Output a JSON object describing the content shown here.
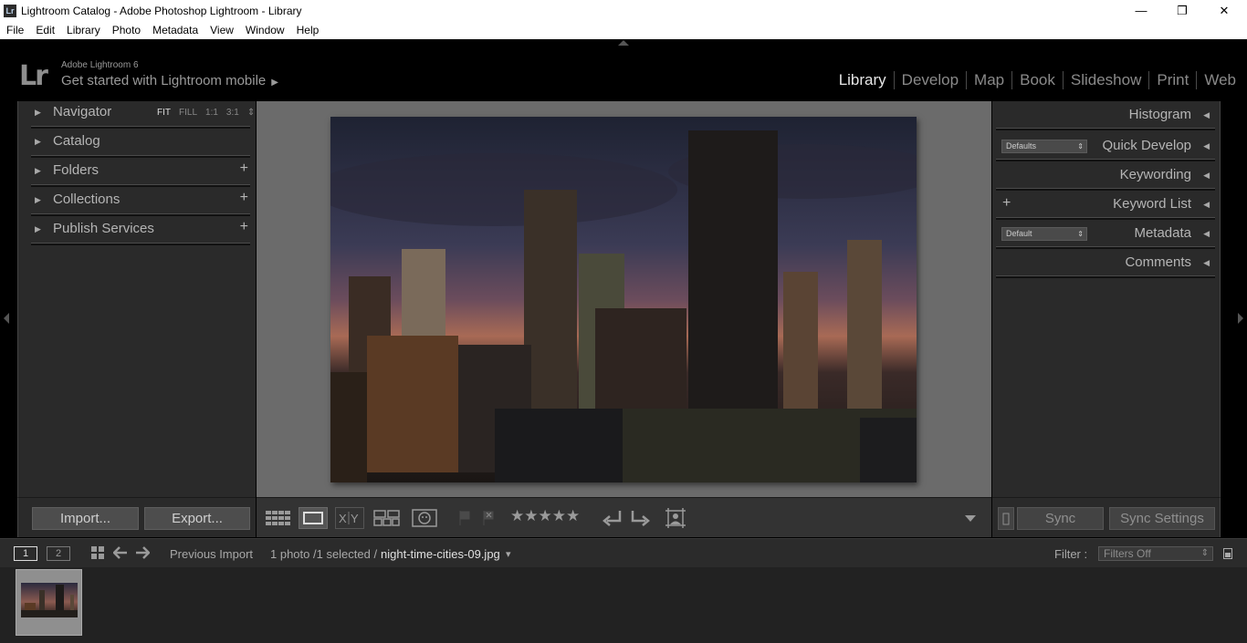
{
  "window": {
    "app_badge": "Lr",
    "title": "Lightroom Catalog - Adobe Photoshop Lightroom - Library",
    "minimize": "—",
    "restore": "❐",
    "close": "✕"
  },
  "menu": [
    "File",
    "Edit",
    "Library",
    "Photo",
    "Metadata",
    "View",
    "Window",
    "Help"
  ],
  "identity": {
    "logo": "Lr",
    "product": "Adobe Lightroom 6",
    "tagline": "Get started with Lightroom mobile",
    "tagline_arrow": "▶"
  },
  "modules": {
    "active": "Library",
    "items": [
      "Library",
      "Develop",
      "Map",
      "Book",
      "Slideshow",
      "Print",
      "Web"
    ]
  },
  "left_panel": {
    "navigator": {
      "label": "Navigator",
      "zoom": [
        "FIT",
        "FILL",
        "1:1",
        "3:1"
      ],
      "zoom_active": "FIT",
      "zoom_more": "⇕"
    },
    "catalog": "Catalog",
    "folders": "Folders",
    "collections": "Collections",
    "publish_services": "Publish Services",
    "plus": "+",
    "import_button": "Import...",
    "export_button": "Export..."
  },
  "toolbar": {
    "stars": "★★★★★",
    "rating": 0
  },
  "right_panel": {
    "histogram": "Histogram",
    "quick_develop": {
      "label": "Quick Develop",
      "preset": "Defaults"
    },
    "keywording": "Keywording",
    "keyword_list": "Keyword List",
    "metadata": {
      "label": "Metadata",
      "preset": "Default"
    },
    "comments": "Comments",
    "sync_button": "Sync",
    "sync_settings_button": "Sync Settings",
    "tri": "◀",
    "plus": "+",
    "updown": "⇕"
  },
  "filmstrip_bar": {
    "screen1": "1",
    "screen2": "2",
    "source": "Previous Import",
    "count": "1 photo /1 selected /",
    "filename": "night-time-cities-09.jpg",
    "file_menu_arrow": "▾",
    "filter_label": "Filter :",
    "filter_value": "Filters Off",
    "filter_updown": "⇕"
  },
  "colors": {
    "panel_bg": "#2a2a2a",
    "center_bg": "#6b6b6b",
    "active_module": "#e6e6e6",
    "inactive_module": "#8a8a8a"
  }
}
